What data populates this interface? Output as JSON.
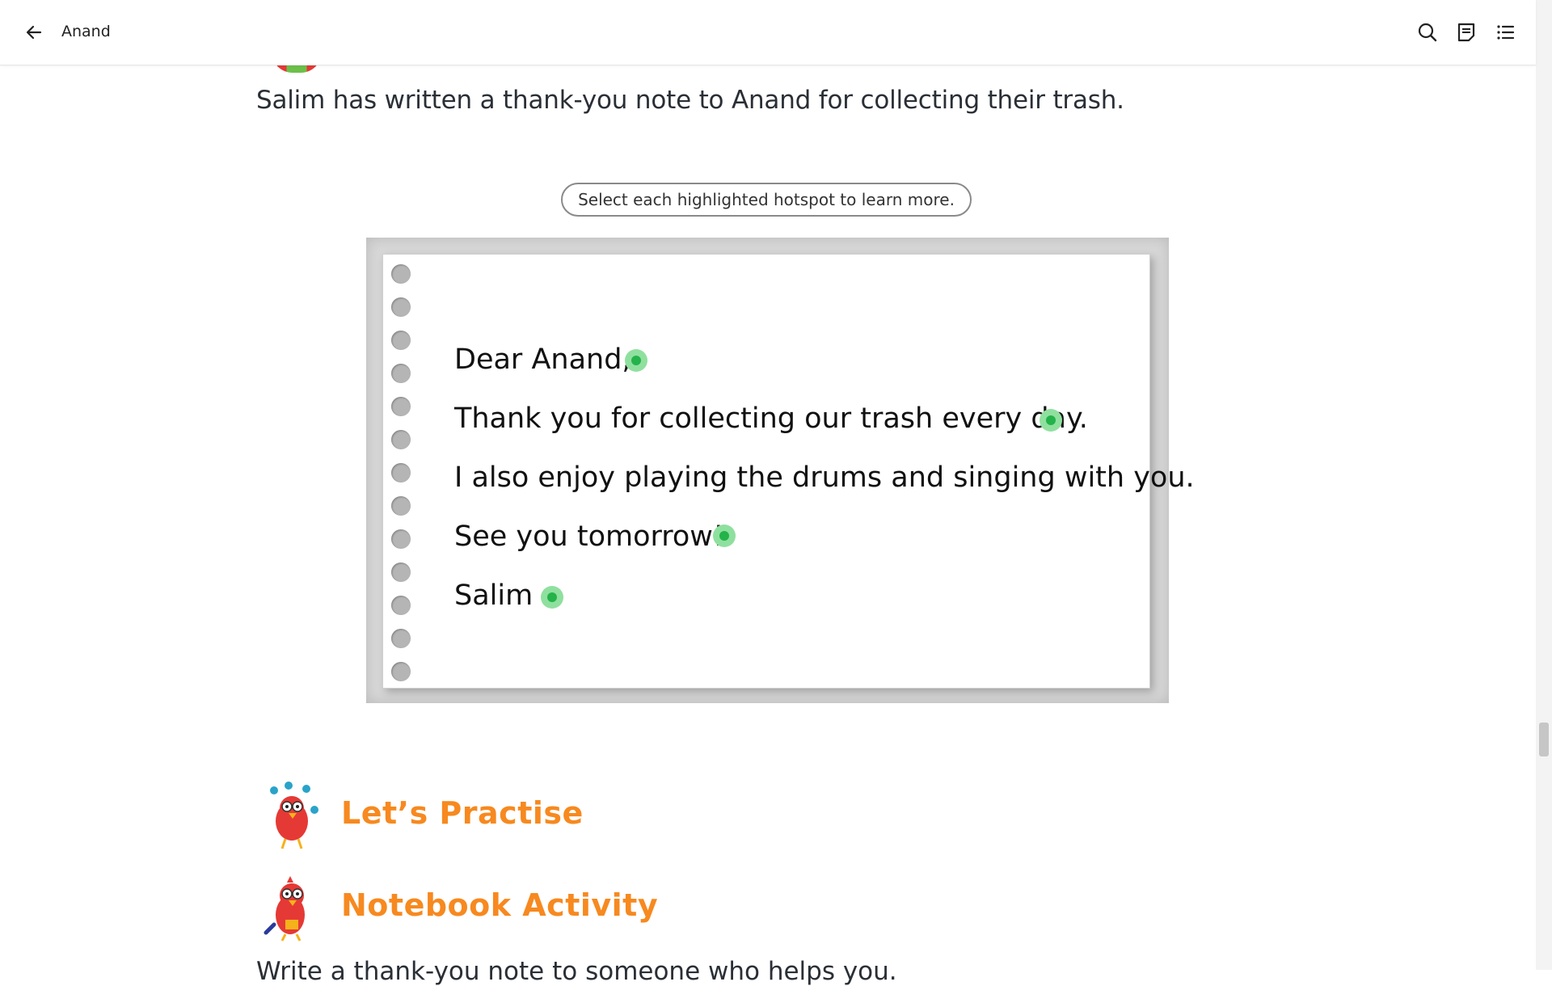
{
  "header": {
    "title": "Anand",
    "back_icon": "arrow-left-icon",
    "actions": [
      "search-icon",
      "notes-icon",
      "table-of-contents-icon"
    ]
  },
  "content": {
    "intro": "Salim has written a thank-you note to Anand for collecting their trash.",
    "instruction": "Select each highlighted hotspot to learn more.",
    "note": {
      "greeting": "Dear Anand,",
      "line1": "Thank you for collecting our trash every day.",
      "line2": "I also enjoy playing the drums and singing with you.",
      "closing": "See you tomorrow!",
      "signature": "Salim"
    },
    "sections": {
      "practise": "Let’s Practise",
      "notebook": "Notebook Activity"
    },
    "next_paragraph": "Write a thank-you note to someone who helps you."
  },
  "colors": {
    "accent_orange": "#f7891f",
    "hotspot_green": "#24b24a",
    "hotspot_halo": "#8fe09e"
  }
}
